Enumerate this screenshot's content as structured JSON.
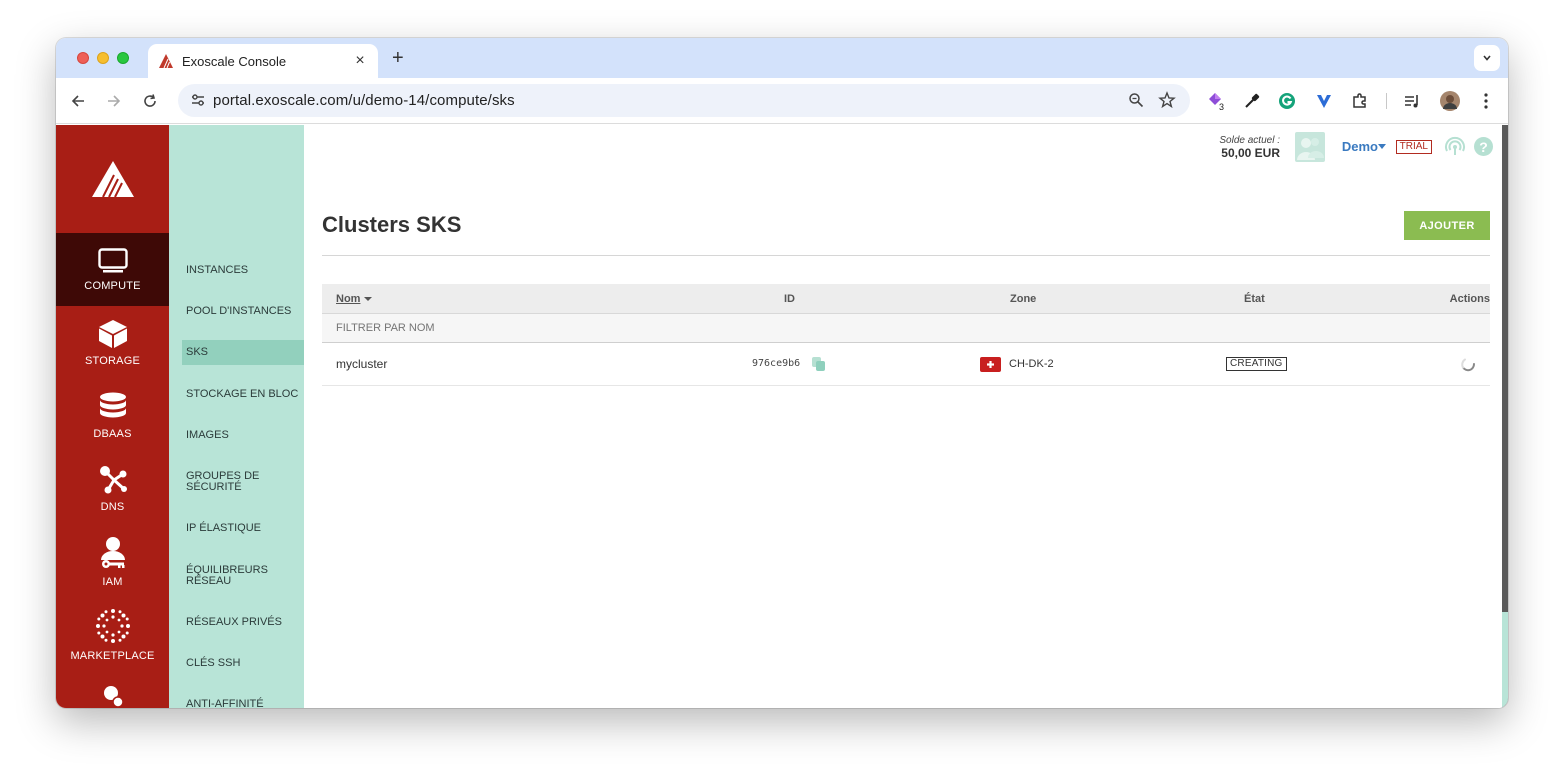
{
  "browser": {
    "tab_title": "Exoscale Console",
    "url": "portal.exoscale.com/u/demo-14/compute/sks",
    "extension_badge": "3"
  },
  "rail": {
    "items": [
      {
        "label": "COMPUTE",
        "icon": "monitor-icon"
      },
      {
        "label": "STORAGE",
        "icon": "box-icon"
      },
      {
        "label": "DBAAS",
        "icon": "database-icon"
      },
      {
        "label": "DNS",
        "icon": "dns-nodes-icon"
      },
      {
        "label": "IAM",
        "icon": "user-key-icon"
      },
      {
        "label": "MARKETPLACE",
        "icon": "marketplace-dots-icon"
      }
    ]
  },
  "subnav": {
    "items": [
      {
        "label": "INSTANCES"
      },
      {
        "label": "POOL D'INSTANCES"
      },
      {
        "label": "SKS"
      },
      {
        "label": "STOCKAGE EN BLOC"
      },
      {
        "label": "IMAGES"
      },
      {
        "label": "GROUPES DE SÉCURITÉ"
      },
      {
        "label": "IP ÉLASTIQUE"
      },
      {
        "label": "ÉQUILIBREURS RÉSEAU"
      },
      {
        "label": "RÉSEAUX PRIVÉS"
      },
      {
        "label": "CLÉS SSH"
      },
      {
        "label": "ANTI-AFFINITÉ"
      }
    ]
  },
  "header": {
    "balance_label": "Solde actuel :",
    "balance_value": "50,00 EUR",
    "user_name": "Demo",
    "trial_badge": "TRIAL",
    "help": "?"
  },
  "page": {
    "title": "Clusters SKS",
    "add_button": "AJOUTER"
  },
  "table": {
    "columns": {
      "name": "Nom",
      "id": "ID",
      "zone": "Zone",
      "state": "État",
      "actions": "Actions"
    },
    "filter_placeholder": "FILTRER PAR NOM",
    "rows": [
      {
        "name": "mycluster",
        "id": "976ce9b6",
        "zone": "CH-DK-2",
        "state": "CREATING"
      }
    ]
  },
  "colors": {
    "rail": "#a81e15",
    "rail_active": "#3e0906",
    "subnav": "#b8e4d7",
    "subnav_active": "#92d0bd",
    "accent_button": "#8bbc51",
    "link": "#3a7ac0"
  }
}
